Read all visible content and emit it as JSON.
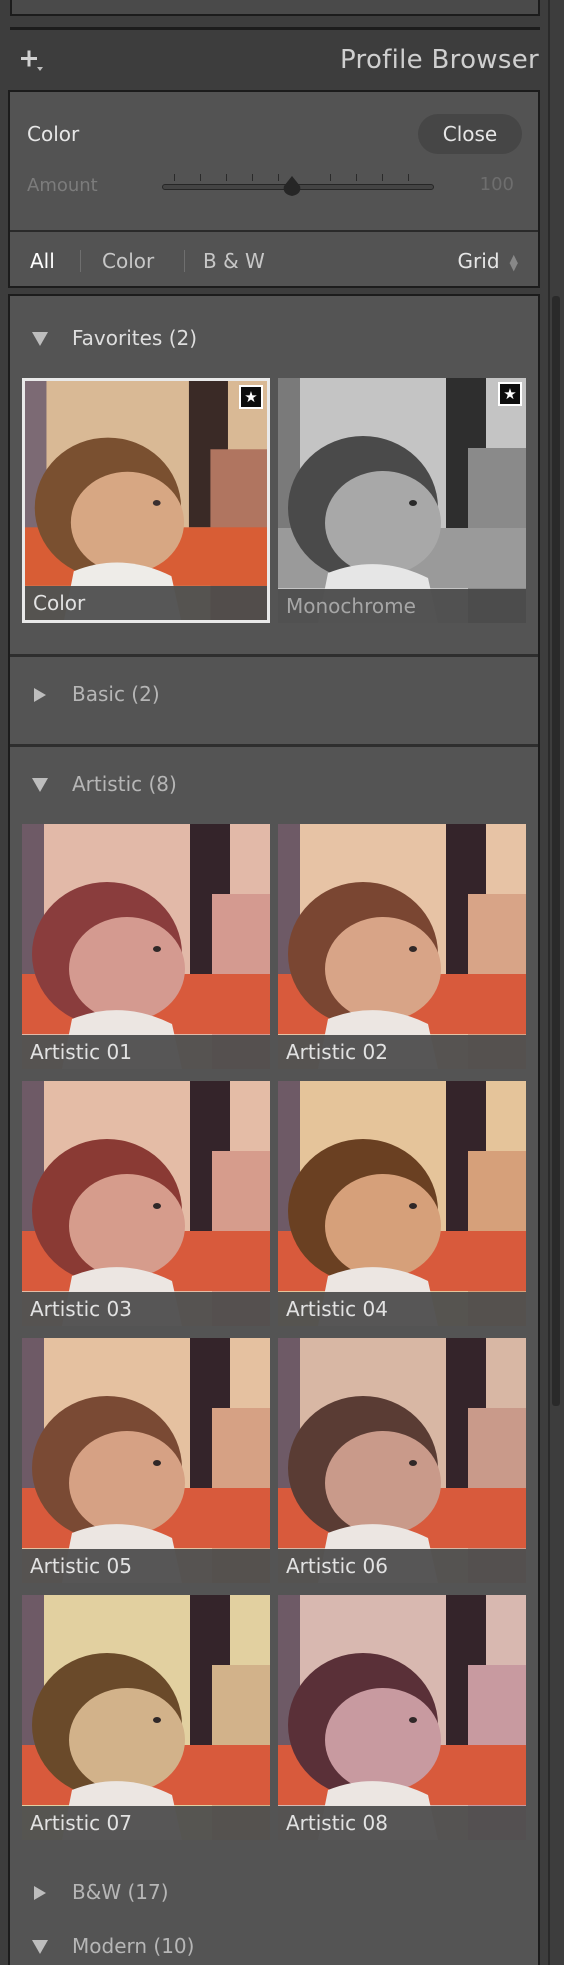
{
  "header": {
    "title": "Profile Browser",
    "add_icon": "plus-with-dropdown-icon"
  },
  "panel": {
    "profile_name": "Color",
    "close_label": "Close",
    "amount_label": "Amount",
    "amount_value": "100",
    "amount_level_percent": 50,
    "filters": [
      "All",
      "Color",
      "B & W"
    ],
    "active_filter": "All",
    "view_label": "Grid"
  },
  "groups": {
    "favorites": {
      "label": "Favorites (2)",
      "expanded": true,
      "items": [
        {
          "caption": "Color",
          "favorite": true,
          "selected": true,
          "tone": "color"
        },
        {
          "caption": "Monochrome",
          "favorite": true,
          "selected": false,
          "tone": "mono"
        }
      ]
    },
    "basic": {
      "label": "Basic (2)",
      "expanded": false
    },
    "artistic": {
      "label": "Artistic (8)",
      "expanded": true,
      "items": [
        {
          "caption": "Artistic 01"
        },
        {
          "caption": "Artistic 02"
        },
        {
          "caption": "Artistic 03"
        },
        {
          "caption": "Artistic 04"
        },
        {
          "caption": "Artistic 05"
        },
        {
          "caption": "Artistic 06"
        },
        {
          "caption": "Artistic 07"
        },
        {
          "caption": "Artistic 08"
        }
      ]
    },
    "bw": {
      "label": "B&W (17)",
      "expanded": false
    },
    "modern": {
      "label": "Modern (10)",
      "expanded": true
    }
  },
  "badge_glyph": "★"
}
